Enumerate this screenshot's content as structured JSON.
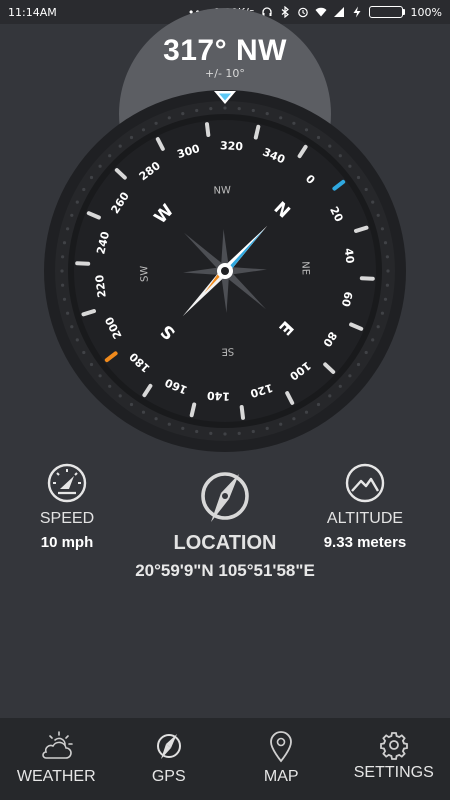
{
  "status_bar": {
    "time": "11:14AM",
    "network_speed": "0.00K/s",
    "battery": "100%",
    "battery_level": 1.0,
    "battery_color": "#22c55e",
    "icons": [
      "dots-icon",
      "headset-icon",
      "bluetooth-icon",
      "alarm-icon",
      "wifi-icon",
      "signal-icon",
      "charging-icon",
      "battery-icon"
    ]
  },
  "heading": {
    "value": "317° NW",
    "accuracy": "+/- 10°",
    "degrees": 317,
    "pointer_color": "#5bc8f5"
  },
  "compass": {
    "degree_labels": [
      "0",
      "20",
      "40",
      "60",
      "80",
      "100",
      "120",
      "140",
      "160",
      "180",
      "200",
      "220",
      "240",
      "260",
      "280",
      "300",
      "320",
      "340"
    ],
    "cardinals": [
      "N",
      "E",
      "S",
      "W"
    ],
    "intercardinals": [
      "NE",
      "SE",
      "SW",
      "NW"
    ],
    "north_marker_color": "#2fa8e0",
    "south_marker_color": "#f08a1c"
  },
  "speed": {
    "label": "SPEED",
    "value": "10 mph"
  },
  "location": {
    "label": "LOCATION",
    "value": "20°59'9\"N 105°51'58\"E"
  },
  "altitude": {
    "label": "ALTITUDE",
    "value": "9.33 meters"
  },
  "nav": {
    "items": [
      {
        "label": "WEATHER",
        "icon": "weather-icon"
      },
      {
        "label": "GPS",
        "icon": "compass-icon"
      },
      {
        "label": "MAP",
        "icon": "map-pin-icon"
      },
      {
        "label": "SETTINGS",
        "icon": "gear-icon"
      }
    ]
  }
}
